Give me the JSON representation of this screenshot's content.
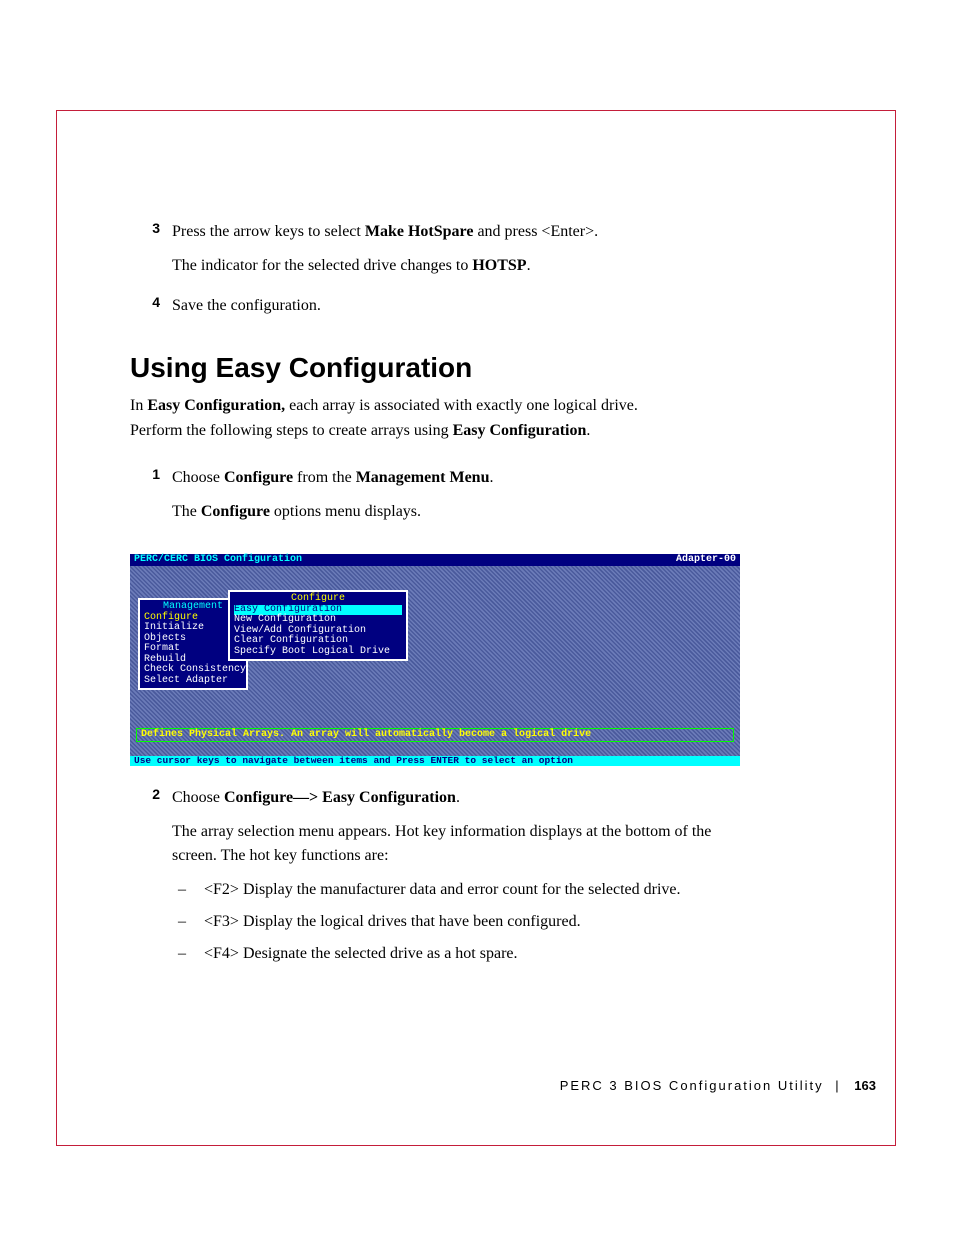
{
  "steps_a": {
    "num3": "3",
    "line3a_pre": "Press the arrow keys to select ",
    "line3a_bold1": "Make HotSpare",
    "line3a_mid": " and press <Enter>.",
    "line3b_pre": "The indicator for the selected drive changes to ",
    "line3b_bold": "HOTSP",
    "line3b_post": ".",
    "num4": "4",
    "line4": "Save the configuration."
  },
  "heading": "Using Easy Configuration",
  "intro": {
    "pre": "In ",
    "b1": "Easy Configuration,",
    "mid": " each array is associated with exactly one logical drive. Perform the following steps to create arrays using ",
    "b2": "Easy Configuration",
    "post": "."
  },
  "steps_b": {
    "num1": "1",
    "s1a_pre": "Choose ",
    "s1a_b1": "Configure",
    "s1a_mid": " from the ",
    "s1a_b2": "Management Menu",
    "s1a_post": ".",
    "s1b_pre": "The ",
    "s1b_b": "Configure",
    "s1b_post": " options menu displays.",
    "num2": "2",
    "s2a_pre": "Choose ",
    "s2a_b": "Configure—> Easy Configuration",
    "s2a_post": ".",
    "s2b": "The array selection menu appears. Hot key information displays at the bottom of the screen. The hot key functions are:",
    "hk": {
      "f2": "<F2>  Display the manufacturer data and error count for the selected drive.",
      "f3": "<F3>  Display the logical drives that have been configured.",
      "f4": "<F4>  Designate the selected drive as a hot spare."
    },
    "dash": "–"
  },
  "bios": {
    "title_left": "PERC/CERC BIOS Configuration",
    "title_right": "Adapter-00",
    "mgmt_title": "Management",
    "mgmt_items": [
      "Configure",
      "Initialize",
      "Objects",
      "Format",
      "Rebuild",
      "Check Consistency",
      "Select Adapter"
    ],
    "conf_title": "Configure",
    "conf_items": [
      "Easy Configuration",
      "New Configuration",
      "View/Add Configuration",
      "Clear Configuration",
      "Specify Boot Logical Drive"
    ],
    "help": "Defines Physical Arrays. An array will automatically become a logical drive",
    "foot": "Use cursor keys to navigate between items and Press ENTER to select an option"
  },
  "footer": {
    "title": "PERC 3 BIOS Configuration Utility",
    "divider": "|",
    "page": "163"
  }
}
